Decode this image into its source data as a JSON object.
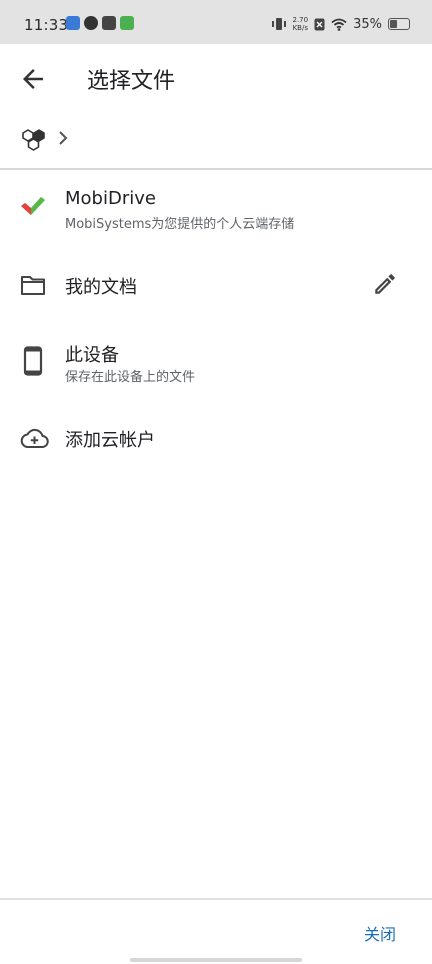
{
  "status_bar": {
    "time": "11:33",
    "network_speed_value": "2.70",
    "network_speed_unit": "KB/s",
    "battery_percent": "35%",
    "battery_level": 0.35
  },
  "toolbar": {
    "title": "选择文件"
  },
  "list": {
    "items": [
      {
        "title": "MobiDrive",
        "subtitle": "MobiSystems为您提供的个人云端存储",
        "icon": "mobidrive-icon"
      },
      {
        "title": "我的文档",
        "subtitle": "",
        "icon": "folder-icon"
      },
      {
        "title": "此设备",
        "subtitle": "保存在此设备上的文件",
        "icon": "phone-icon"
      },
      {
        "title": "添加云帐户",
        "subtitle": "",
        "icon": "cloud-add-icon"
      }
    ]
  },
  "footer": {
    "close_label": "关闭"
  },
  "colors": {
    "accent": "#1a6bb8",
    "status_bar_bg": "#e3e3e3",
    "icon_gray": "#444444"
  }
}
